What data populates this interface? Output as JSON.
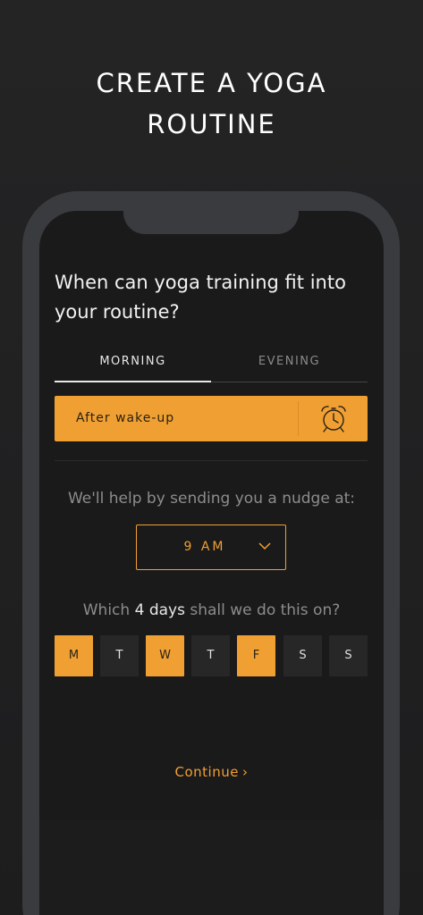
{
  "header": {
    "title_line1": "CREATE A YOGA",
    "title_line2": "ROUTINE"
  },
  "question": "When can yoga training fit into your routine?",
  "tabs": [
    {
      "label": "MORNING",
      "selected": true
    },
    {
      "label": "EVENING",
      "selected": false
    }
  ],
  "time_slot": {
    "label": "After wake-up",
    "icon": "alarm-clock-icon"
  },
  "nudge": {
    "text": "We'll help by sending you a nudge at:",
    "time_value": "9 AM",
    "dropdown_icon": "chevron-down-icon"
  },
  "days_question": {
    "prefix": "Which ",
    "count": "4 days",
    "suffix": " shall we do this on?"
  },
  "days": [
    {
      "label": "M",
      "selected": true
    },
    {
      "label": "T",
      "selected": false
    },
    {
      "label": "W",
      "selected": true
    },
    {
      "label": "T",
      "selected": false
    },
    {
      "label": "F",
      "selected": true
    },
    {
      "label": "S",
      "selected": false
    },
    {
      "label": "S",
      "selected": false
    }
  ],
  "continue": {
    "label": "Continue",
    "arrow": "›"
  },
  "colors": {
    "accent": "#f0a033",
    "background": "#1f1f20",
    "phone_frame": "#3a3b3e",
    "screen": "#1a1a1b"
  }
}
